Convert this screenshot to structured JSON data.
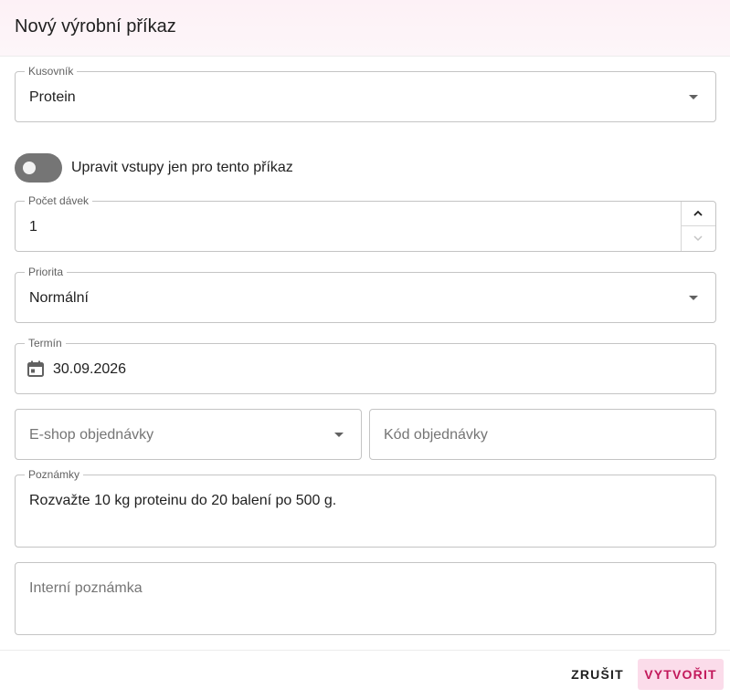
{
  "dialog": {
    "title": "Nový výrobní příkaz",
    "kusovnik": {
      "label": "Kusovník",
      "value": "Protein"
    },
    "toggle": {
      "label": "Upravit vstupy jen pro tento příkaz",
      "checked": false
    },
    "pocet_davek": {
      "label": "Počet dávek",
      "value": "1"
    },
    "priorita": {
      "label": "Priorita",
      "value": "Normální"
    },
    "termin": {
      "label": "Termín",
      "value": "30.09.2026"
    },
    "eshop": {
      "placeholder": "E-shop objednávky"
    },
    "kod": {
      "placeholder": "Kód objednávky"
    },
    "poznamky": {
      "label": "Poznámky",
      "value": "Rozvažte 10 kg proteinu do 20 balení po 500 g."
    },
    "interni": {
      "placeholder": "Interní poznámka"
    },
    "buttons": {
      "cancel": "ZRUŠIT",
      "create": "VYTVOŘIT"
    }
  }
}
